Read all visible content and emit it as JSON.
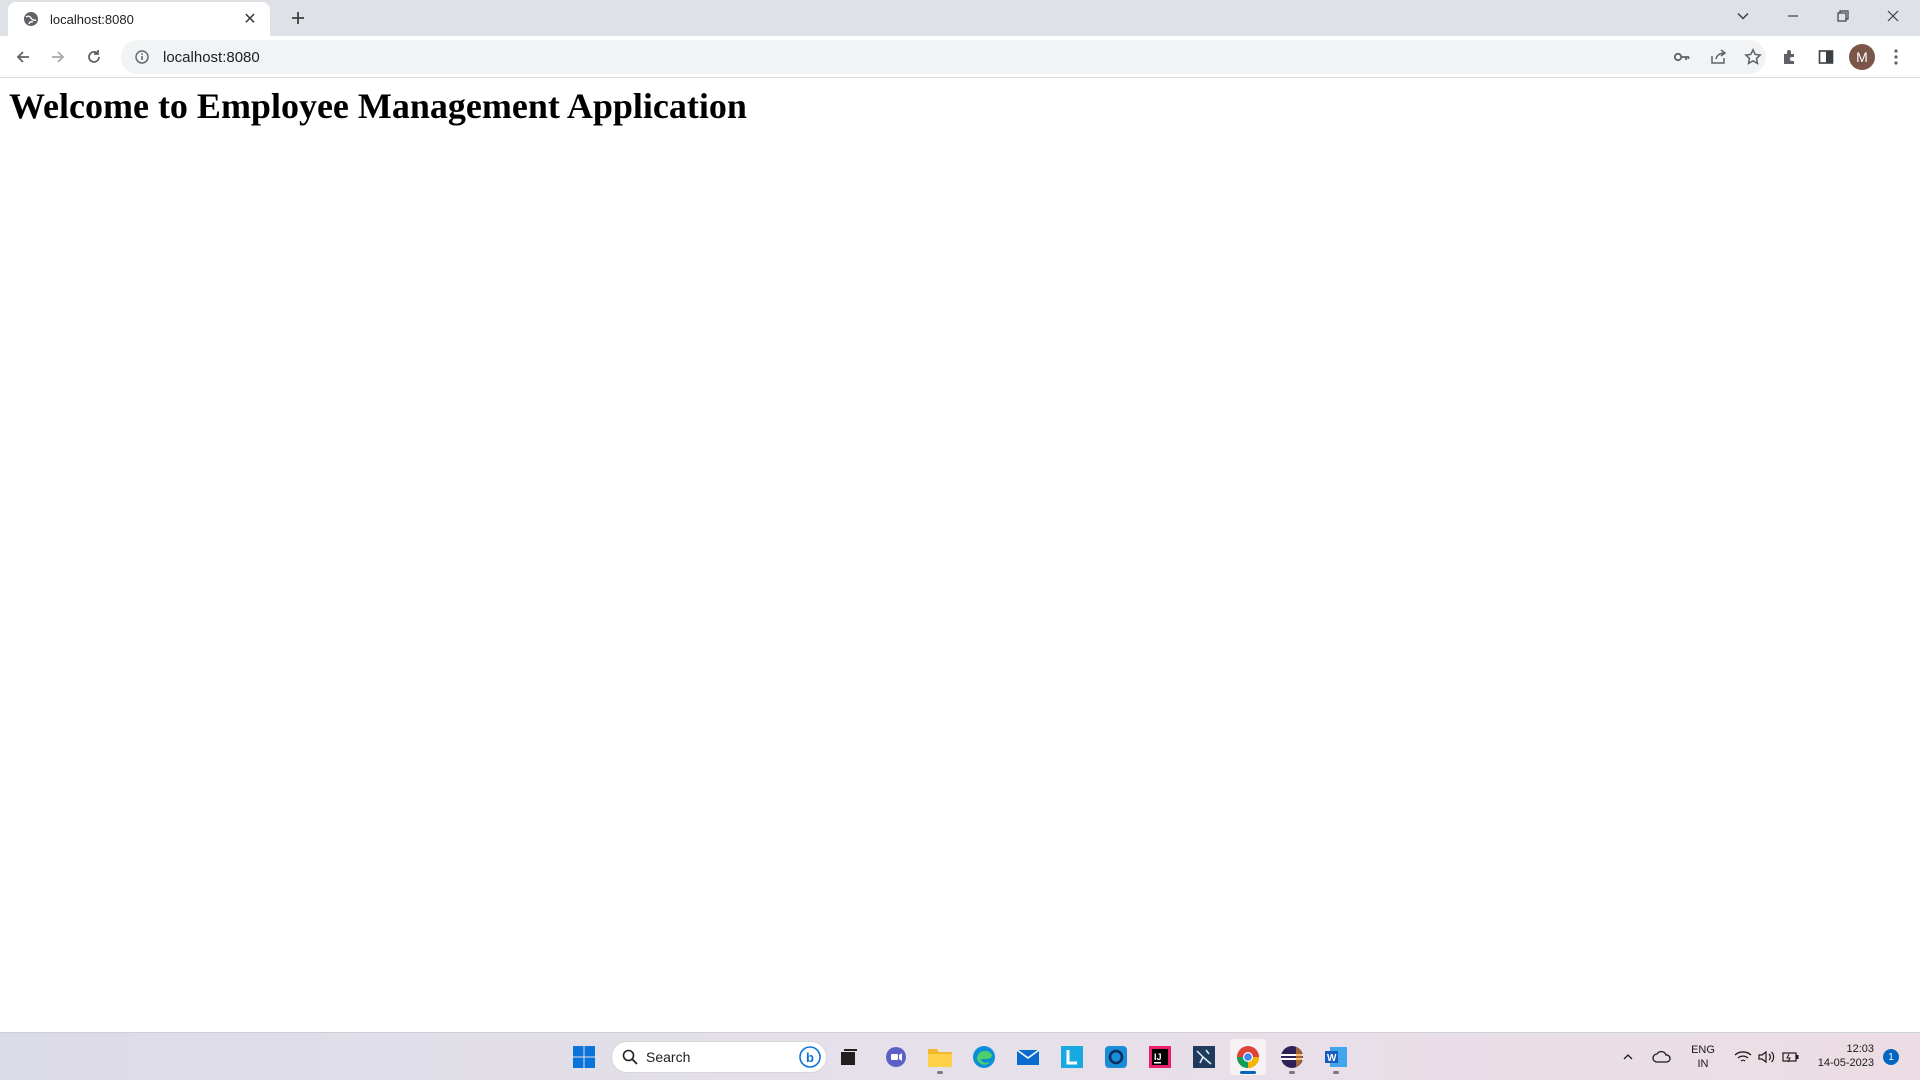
{
  "browser": {
    "tab": {
      "title": "localhost:8080",
      "favicon": "globe-icon"
    },
    "address_bar": {
      "url": "localhost:8080",
      "security_icon": "info-icon"
    },
    "profile": {
      "initial": "M",
      "color": "#7b5548"
    }
  },
  "page": {
    "heading": "Welcome to Employee Management Application"
  },
  "taskbar": {
    "search_label": "Search",
    "apps": [
      "windows-start",
      "search",
      "task-view",
      "teams-chat",
      "file-explorer",
      "edge",
      "mail",
      "l-app",
      "blue-app",
      "intellij",
      "mysql-workbench",
      "chrome",
      "eclipse",
      "word"
    ],
    "active_app": "chrome",
    "tray": {
      "language": "ENG",
      "region": "IN",
      "time": "12:03",
      "date": "14-05-2023",
      "notification_count": "1"
    }
  }
}
